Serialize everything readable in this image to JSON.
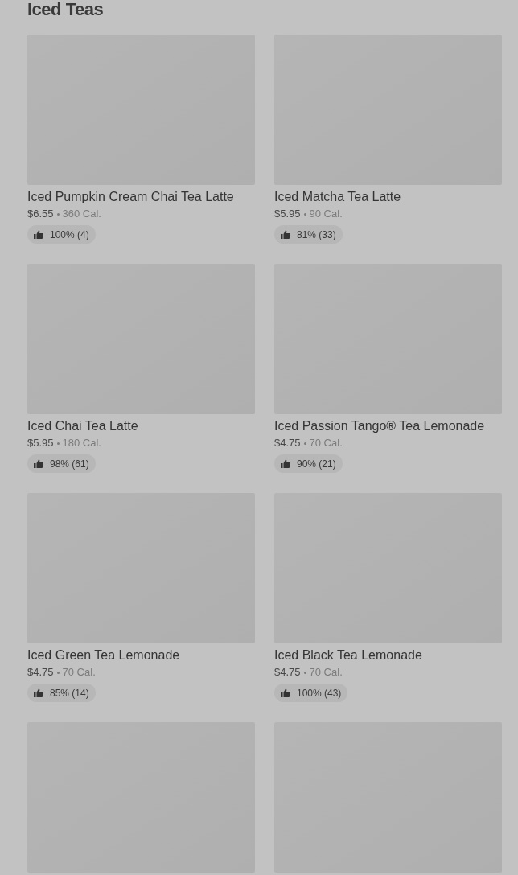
{
  "section": {
    "title": "Iced Teas"
  },
  "items": [
    {
      "kind": "product",
      "name": "Iced Pumpkin Cream Chai Tea Latte",
      "price": "$6.55",
      "calories": "360 Cal.",
      "rating": "100% (4)"
    },
    {
      "kind": "product",
      "name": "Iced Matcha Tea Latte",
      "price": "$5.95",
      "calories": "90 Cal.",
      "rating": "81% (33)"
    },
    {
      "kind": "product",
      "name": "Iced Chai Tea Latte",
      "price": "$5.95",
      "calories": "180 Cal.",
      "rating": "98% (61)"
    },
    {
      "kind": "product",
      "name": "Iced Passion Tango® Tea Lemonade",
      "price": "$4.75",
      "calories": "70 Cal.",
      "rating": "90% (21)"
    },
    {
      "kind": "product",
      "name": "Iced Green Tea Lemonade",
      "price": "$4.75",
      "calories": "70 Cal.",
      "rating": "85% (14)"
    },
    {
      "kind": "product",
      "name": "Iced Black Tea Lemonade",
      "price": "$4.75",
      "calories": "70 Cal.",
      "rating": "100% (43)"
    },
    {
      "kind": "image_only"
    },
    {
      "kind": "image_only"
    }
  ]
}
